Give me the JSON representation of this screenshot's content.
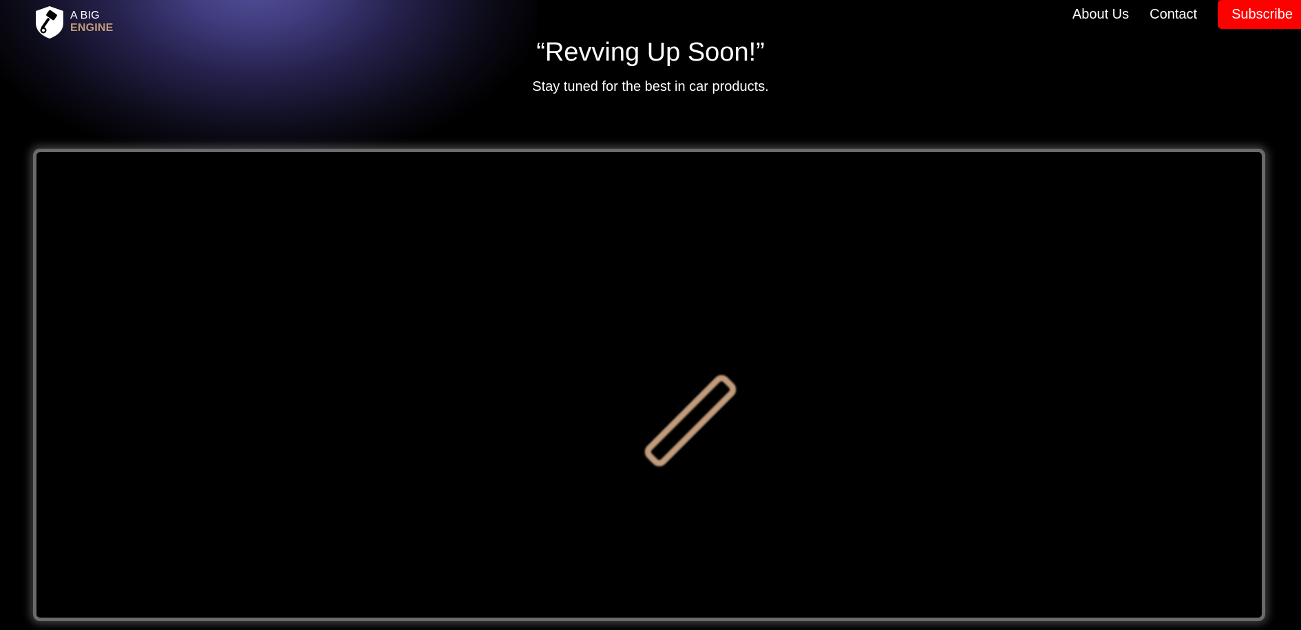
{
  "brand": {
    "line1": "A BIG",
    "line2": "ENGINE",
    "accent_color": "#c29b7b",
    "icon": "shield-piston-icon"
  },
  "nav": {
    "about_label": "About Us",
    "contact_label": "Contact",
    "subscribe_label": "Subscribe",
    "subscribe_color": "#ff0000"
  },
  "hero": {
    "title": "“Revving Up Soon!”",
    "subtitle": "Stay tuned for the best in car products."
  },
  "media": {
    "loader_icon": "loading-bar-icon",
    "loader_color": "#c29b7b",
    "glow_color": "#54509c"
  }
}
